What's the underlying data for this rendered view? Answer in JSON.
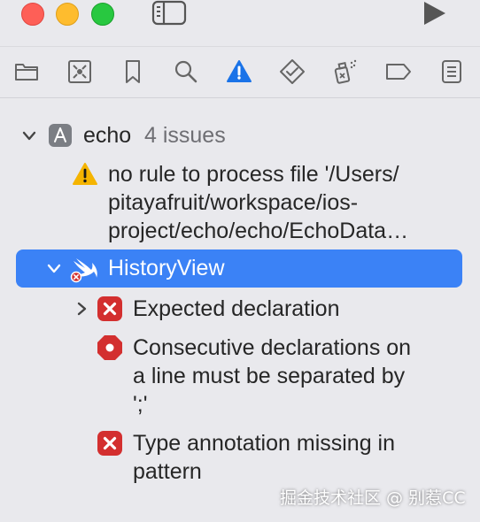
{
  "navigator": {
    "project": {
      "name": "echo",
      "issue_count": "4 issues"
    },
    "warning": {
      "lines": [
        "no rule to process file '/Users/",
        "pitayafruit/workspace/ios-",
        "project/echo/echo/EchoData…"
      ]
    },
    "file": {
      "name": "HistoryView"
    },
    "errors": [
      {
        "lines": [
          "Expected declaration"
        ]
      },
      {
        "lines": [
          "Consecutive declarations on",
          "a line must be separated by",
          "';'"
        ]
      },
      {
        "lines": [
          "Type annotation missing in",
          "pattern"
        ]
      }
    ]
  },
  "colors": {
    "selection": "#3b82f6",
    "error": "#d32f2f",
    "warning": "#f5b400",
    "active_tab": "#1a73e8"
  },
  "watermark": "掘金技术社区 @ 别惹CC"
}
